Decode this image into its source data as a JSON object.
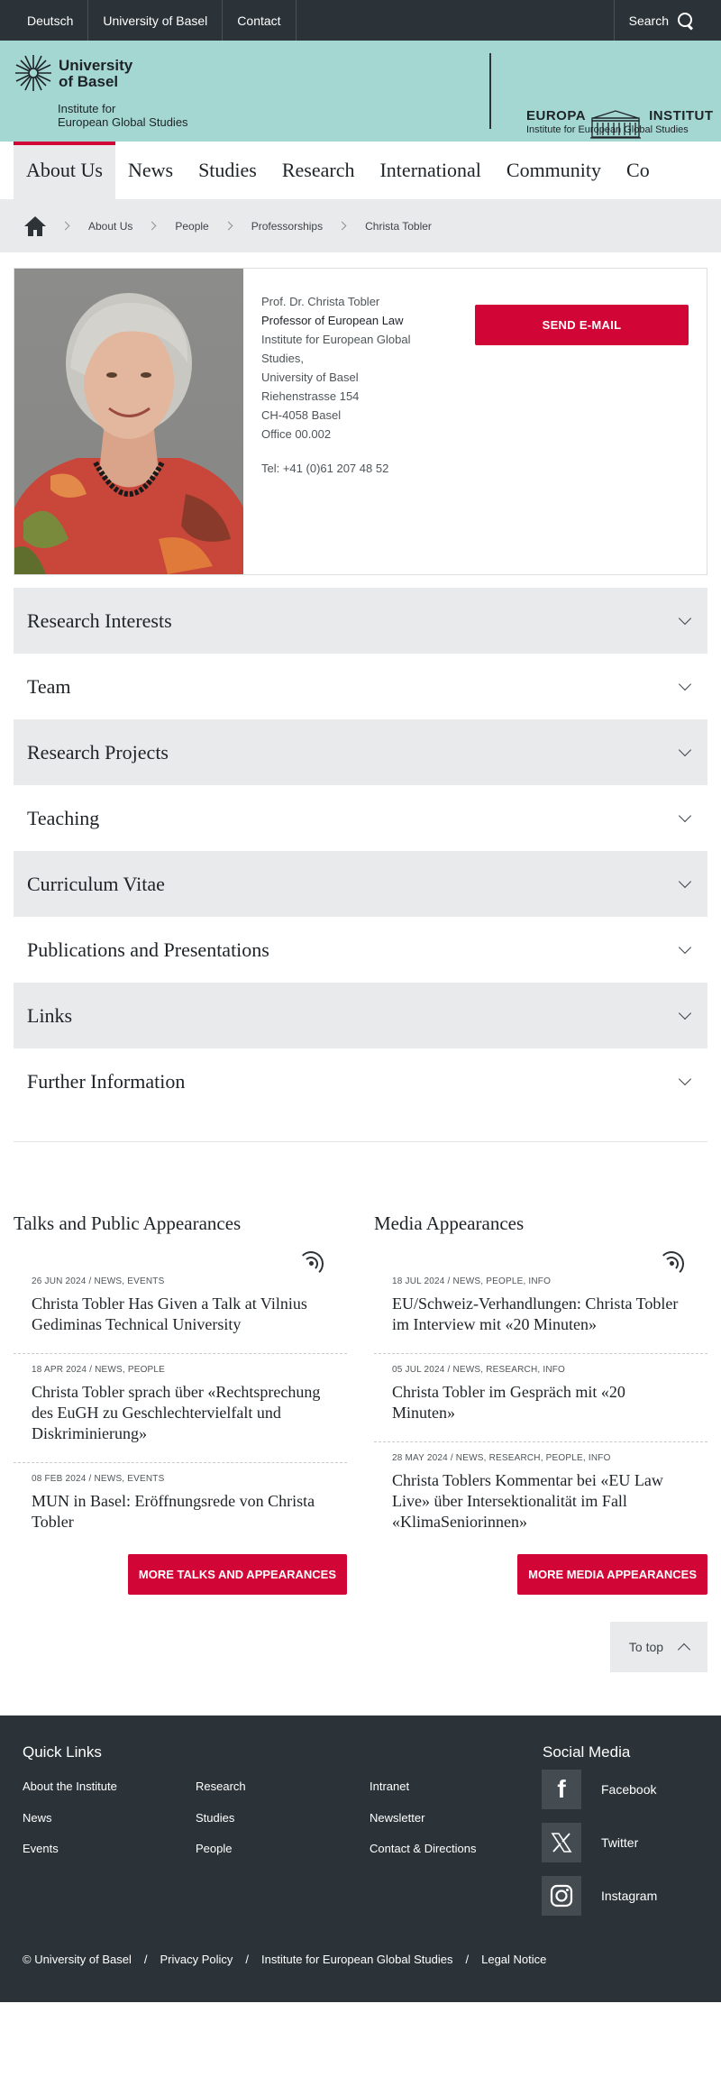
{
  "topbar": {
    "links": [
      "Deutsch",
      "University of Basel",
      "Contact"
    ],
    "search_label": "Search"
  },
  "header": {
    "university_line1": "University",
    "university_line2": "of Basel",
    "institute_line1": "Institute for",
    "institute_line2": "European Global Studies",
    "europa_word1": "EUROPA",
    "europa_word2": "INSTITUT",
    "europa_sub": "Institute for European Global Studies"
  },
  "mainnav": [
    "About Us",
    "News",
    "Studies",
    "Research",
    "International",
    "Community",
    "Co"
  ],
  "breadcrumb": [
    "About Us",
    "People",
    "Professorships",
    "Christa Tobler"
  ],
  "profile": {
    "name": "Prof. Dr. Christa Tobler",
    "role": "Professor of European Law",
    "inst1": "Institute for European Global",
    "inst2": "Studies,",
    "uni": "University of Basel",
    "street": "Riehenstrasse 154",
    "city": "CH-4058 Basel",
    "office": "Office 00.002",
    "tel": "Tel: +41 (0)61 207 48 52",
    "email_button": "SEND E-MAIL"
  },
  "accordion": [
    "Research Interests",
    "Team",
    "Research Projects",
    "Teaching",
    "Curriculum Vitae",
    "Publications and Presentations",
    "Links",
    "Further Information"
  ],
  "talks": {
    "heading": "Talks and Public Appearances",
    "items": [
      {
        "meta": "26 JUN 2024 / NEWS, EVENTS",
        "title": "Christa Tobler Has Given a Talk at Vilnius Gediminas Technical University"
      },
      {
        "meta": "18 APR 2024 / NEWS, PEOPLE",
        "title": "Christa Tobler sprach über «Rechtsprechung des EuGH zu Geschlechtervielfalt und Diskriminierung»"
      },
      {
        "meta": "08 FEB 2024 / NEWS, EVENTS",
        "title": "MUN in Basel: Eröffnungsrede von Christa Tobler"
      }
    ],
    "more": "MORE TALKS AND APPEARANCES"
  },
  "media": {
    "heading": "Media Appearances",
    "items": [
      {
        "meta": "18 JUL 2024 / NEWS, PEOPLE, INFO",
        "title": "EU/Schweiz-Verhandlungen: Christa Tobler im Interview mit «20 Minuten»"
      },
      {
        "meta": "05 JUL 2024 / NEWS, RESEARCH, INFO",
        "title": "Christa Tobler im Gespräch mit «20 Minuten»"
      },
      {
        "meta": "28 MAY 2024 / NEWS, RESEARCH, PEOPLE, INFO",
        "title": "Christa Toblers Kommentar bei «EU Law Live» über Intersektionalität im Fall «KlimaSeniorinnen»"
      }
    ],
    "more": "MORE MEDIA APPEARANCES"
  },
  "totop": "To top",
  "footer": {
    "quick_links_heading": "Quick Links",
    "col1": [
      "About the Institute",
      "News",
      "Events"
    ],
    "col2": [
      "Research",
      "Studies",
      "People"
    ],
    "col3": [
      "Intranet",
      "Newsletter",
      "Contact & Directions"
    ],
    "social_heading": "Social Media",
    "social": [
      "Facebook",
      "Twitter",
      "Instagram"
    ],
    "legal": [
      "© University of Basel",
      "/",
      "Privacy Policy",
      "/",
      "Institute for European Global Studies",
      "/",
      "Legal Notice"
    ]
  },
  "colors": {
    "accent": "#d20537",
    "header_bg": "#a5d7d2",
    "dark": "#2b3338",
    "light_gray": "#e9eaeb"
  }
}
